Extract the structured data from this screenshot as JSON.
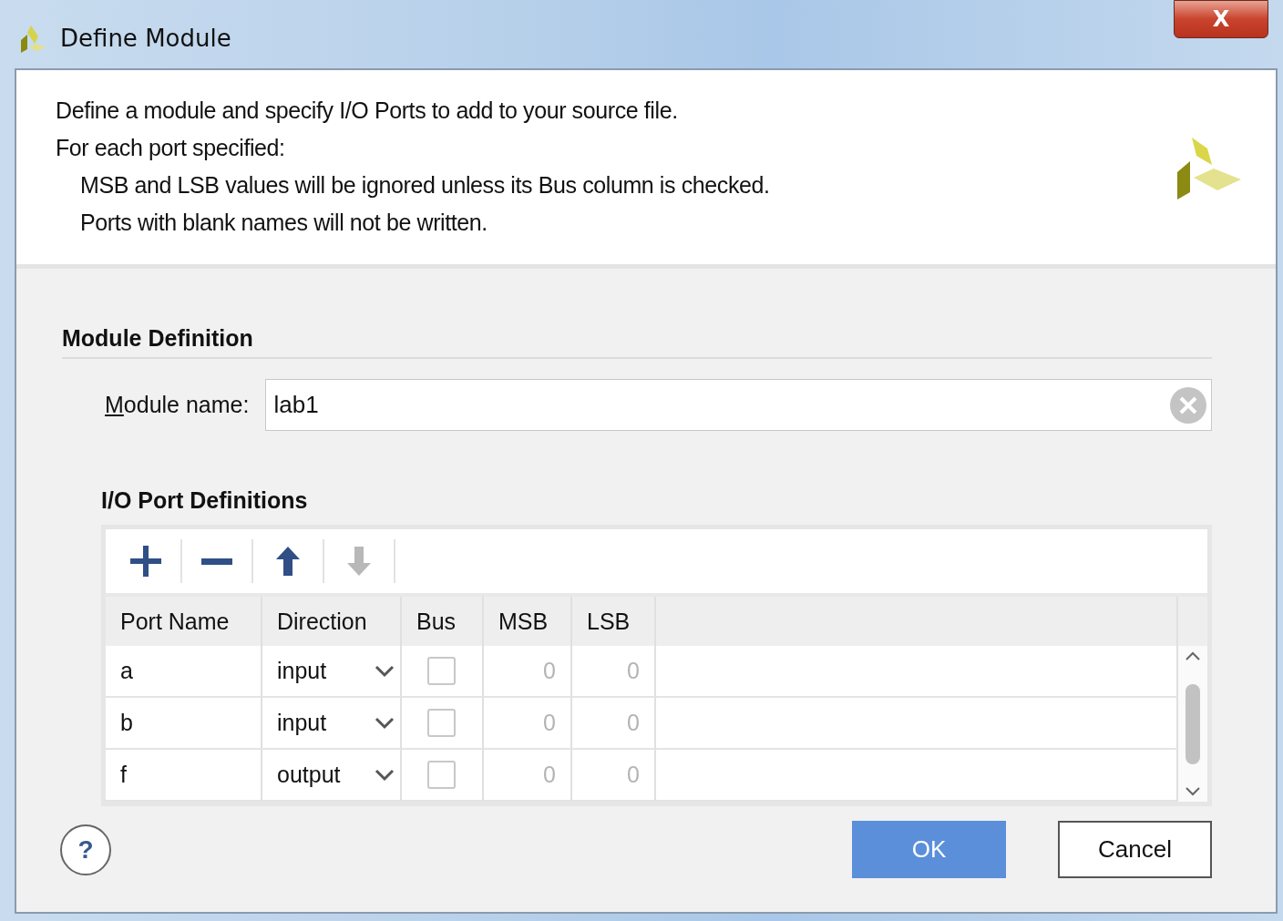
{
  "window": {
    "title": "Define Module",
    "close_label": "X"
  },
  "description": [
    {
      "kind": "line",
      "text": "Define a module and specify I/O Ports to add to your source file."
    },
    {
      "kind": "line",
      "text": "For each port specified:"
    },
    {
      "kind": "indented",
      "text": "MSB and LSB values will be ignored unless its Bus column is checked."
    },
    {
      "kind": "indented",
      "text": "Ports with blank names will not be written."
    }
  ],
  "module_definition": {
    "heading": "Module Definition",
    "label": "Module name:",
    "value": "lab1"
  },
  "io_ports": {
    "heading": "I/O Port Definitions",
    "toolbar": [
      {
        "kind": "add",
        "disabled": false
      },
      {
        "kind": "remove",
        "disabled": false
      },
      {
        "kind": "up",
        "disabled": false
      },
      {
        "kind": "down",
        "disabled": true
      }
    ],
    "columns": [
      "Port Name",
      "Direction",
      "Bus",
      "MSB",
      "LSB"
    ],
    "rows": [
      {
        "name": "a",
        "direction": "input",
        "bus": false,
        "msb": "0",
        "lsb": "0"
      },
      {
        "name": "b",
        "direction": "input",
        "bus": false,
        "msb": "0",
        "lsb": "0"
      },
      {
        "name": "f",
        "direction": "output",
        "bus": false,
        "msb": "0",
        "lsb": "0"
      }
    ]
  },
  "footer": {
    "help": "?",
    "buttons": [
      {
        "label": "OK",
        "kind": "primary"
      },
      {
        "label": "Cancel",
        "kind": "secondary"
      }
    ]
  }
}
